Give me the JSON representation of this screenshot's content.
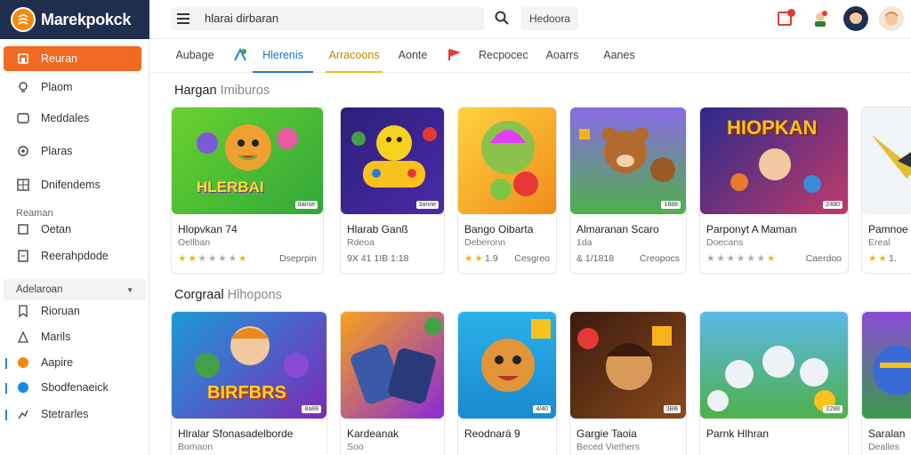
{
  "app": {
    "logo_text": "Marekpokck"
  },
  "search": {
    "value": "hlarai dirbaran"
  },
  "header": {
    "filter_label": "Hedoora"
  },
  "sidebar": {
    "items": [
      {
        "label": "Reuran",
        "icon": "home-icon"
      },
      {
        "label": "Plaom",
        "icon": "bulb-icon"
      },
      {
        "label": "Meddales",
        "icon": "list-icon"
      },
      {
        "label": "Plaras",
        "icon": "settings-icon"
      },
      {
        "label": "Dnifendems",
        "icon": "grid-icon"
      }
    ],
    "section_label": "Reaman",
    "section_items": [
      {
        "label": "Oetan",
        "icon": "box-icon"
      },
      {
        "label": "Reerahpdode",
        "icon": "doc-icon"
      }
    ],
    "expand_label": "Adelaroan",
    "lower_items": [
      {
        "label": "Rioruan",
        "icon": "bookmark-icon"
      },
      {
        "label": "Marils",
        "icon": "user-icon"
      },
      {
        "label": "Aapire",
        "icon": "orange-dot-icon"
      },
      {
        "label": "Sbodfenaeick",
        "icon": "blue-dot-icon"
      },
      {
        "label": "Stetrarles",
        "icon": "chart-icon"
      }
    ]
  },
  "tabs": [
    "Aubage",
    "Hlerenis",
    "Arracoons",
    "Aonte",
    "Recpocec",
    "Aoarrs",
    "Aanes"
  ],
  "sections": [
    {
      "title": "Hargan",
      "subtitle": "Imiburos",
      "cards": [
        {
          "name": "Hlopvkan 74",
          "meta": "Oellban",
          "rating": "",
          "detail": "Dseprpin",
          "stars": 4
        },
        {
          "name": "Hlarab Ganß",
          "meta": "Rdeoa",
          "rating": "9X 41 1IB 1:18",
          "detail": "",
          "stars": 0
        },
        {
          "name": "Bango Oibarta",
          "meta": "Deberonn",
          "rating": "1.9",
          "detail": "Cesgreo",
          "stars": 2
        },
        {
          "name": "Almaranan Scaro",
          "meta": "1da",
          "rating": "& 1/1818",
          "detail": "Creopocs",
          "stars": 0
        },
        {
          "name": "Parponyt A Maman",
          "meta": "Doecans",
          "rating": "",
          "detail": "Caerdoo",
          "stars": 5
        },
        {
          "name": "Pamnoe k",
          "meta": "Ereal",
          "rating": "1.",
          "detail": "",
          "stars": 2
        }
      ]
    },
    {
      "title": "Corgraal",
      "subtitle": "Hlhopons",
      "cards": [
        {
          "name": "Hlralar Sfonasadelborde",
          "meta": "Bomaon",
          "rating": "",
          "detail": "",
          "stars": 0
        },
        {
          "name": "Kardeanak",
          "meta": "Soo",
          "rating": "",
          "detail": "",
          "stars": 0
        },
        {
          "name": "Reodnarä 9",
          "meta": "",
          "rating": "",
          "detail": "",
          "stars": 0
        },
        {
          "name": "Gargie Taoia",
          "meta": "Beced Viethers",
          "rating": "",
          "detail": "",
          "stars": 0
        },
        {
          "name": "Parnk Hlhran",
          "meta": "",
          "rating": "",
          "detail": "",
          "stars": 0
        },
        {
          "name": "Saralan",
          "meta": "Dealles",
          "rating": "",
          "detail": "",
          "stars": 0
        }
      ]
    }
  ],
  "thumbs": {
    "s0": [
      {
        "text": "HLERBAI",
        "tag": "8anse",
        "bg": "#5fbf2a"
      },
      {
        "text": "",
        "tag": "3anne",
        "bg": "#3b2a8f"
      },
      {
        "text": "",
        "tag": "",
        "bg": "#f7b21c"
      },
      {
        "text": "",
        "tag": "1888",
        "bg": "#7b5ad6"
      },
      {
        "text": "HIOPKAN",
        "tag": "2480",
        "bg": "#1d2f7a"
      },
      {
        "text": "",
        "tag": "",
        "bg": "#eef3f7"
      }
    ],
    "s1": [
      {
        "text": "BIRFBRS",
        "tag": "8a88",
        "bg": "#1b9bd8"
      },
      {
        "text": "",
        "tag": "",
        "bg": "#6c2ec4"
      },
      {
        "text": "",
        "tag": "4/40",
        "bg": "#24a6e6"
      },
      {
        "text": "",
        "tag": "3BB",
        "bg": "#2a1a1a"
      },
      {
        "text": "",
        "tag": "2288",
        "bg": "#4fb37a"
      },
      {
        "text": "",
        "tag": "",
        "bg": "#7a3ab8"
      }
    ]
  }
}
